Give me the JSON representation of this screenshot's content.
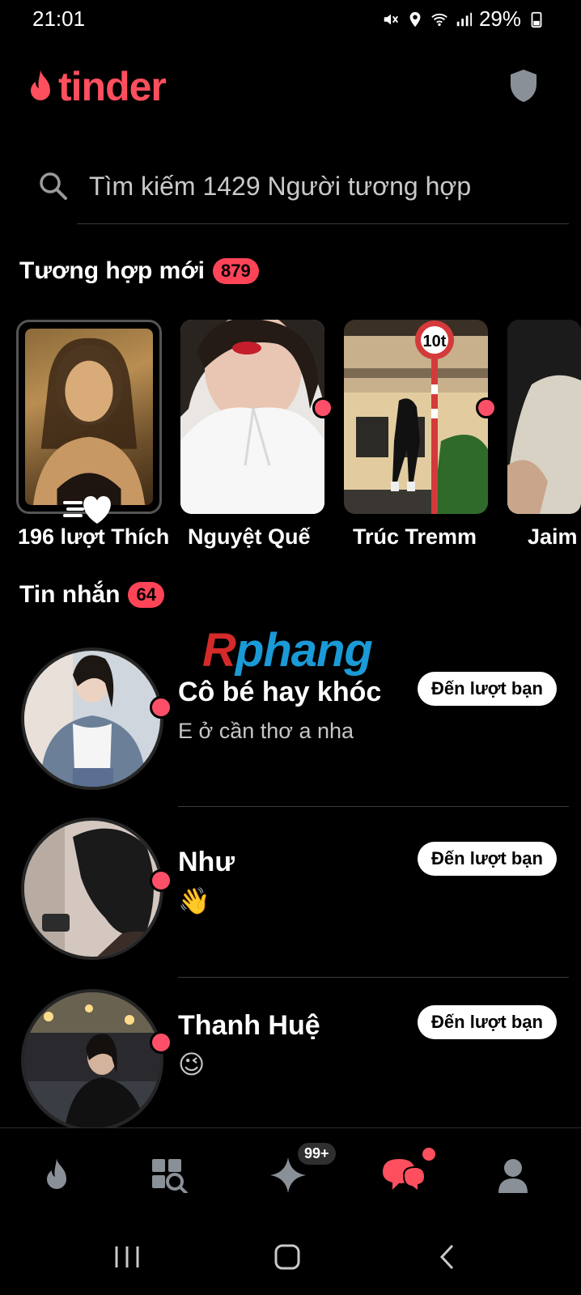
{
  "status_bar": {
    "time": "21:01",
    "battery": "29%",
    "icons": [
      "mute-icon",
      "location-icon",
      "wifi-icon",
      "signal-icon",
      "battery-icon"
    ]
  },
  "header": {
    "logo_text": "tinder",
    "brand_color": "#fd4f5d",
    "shield_icon": "shield-icon"
  },
  "search": {
    "placeholder": "Tìm kiếm 1429 Người tương hợp"
  },
  "new_matches": {
    "title": "Tương hợp mới",
    "count": "879",
    "likes_label": "196 lượt Thích",
    "items": [
      {
        "name": "Nguyệt Quế"
      },
      {
        "name": "Trúc Tremm"
      },
      {
        "name": "Jaim"
      }
    ],
    "sign_text": "10t"
  },
  "messages": {
    "title": "Tin nhắn",
    "count": "64",
    "turn_label": "Đến lượt bạn",
    "items": [
      {
        "name": "Cô bé hay khóc",
        "preview": "E ở cần thơ a nha"
      },
      {
        "name": "Như",
        "preview": "👋"
      },
      {
        "name": "Thanh Huệ",
        "preview": "😉"
      }
    ]
  },
  "watermark": {
    "part1": "R",
    "part2": "phang"
  },
  "bottom_nav": {
    "items": [
      "home-icon",
      "explore-icon",
      "top-picks-icon",
      "chat-icon",
      "profile-icon"
    ],
    "top_picks_badge": "99+",
    "active": "chat-icon"
  },
  "system_nav": {
    "buttons": [
      "recents-button",
      "home-button",
      "back-button"
    ]
  }
}
